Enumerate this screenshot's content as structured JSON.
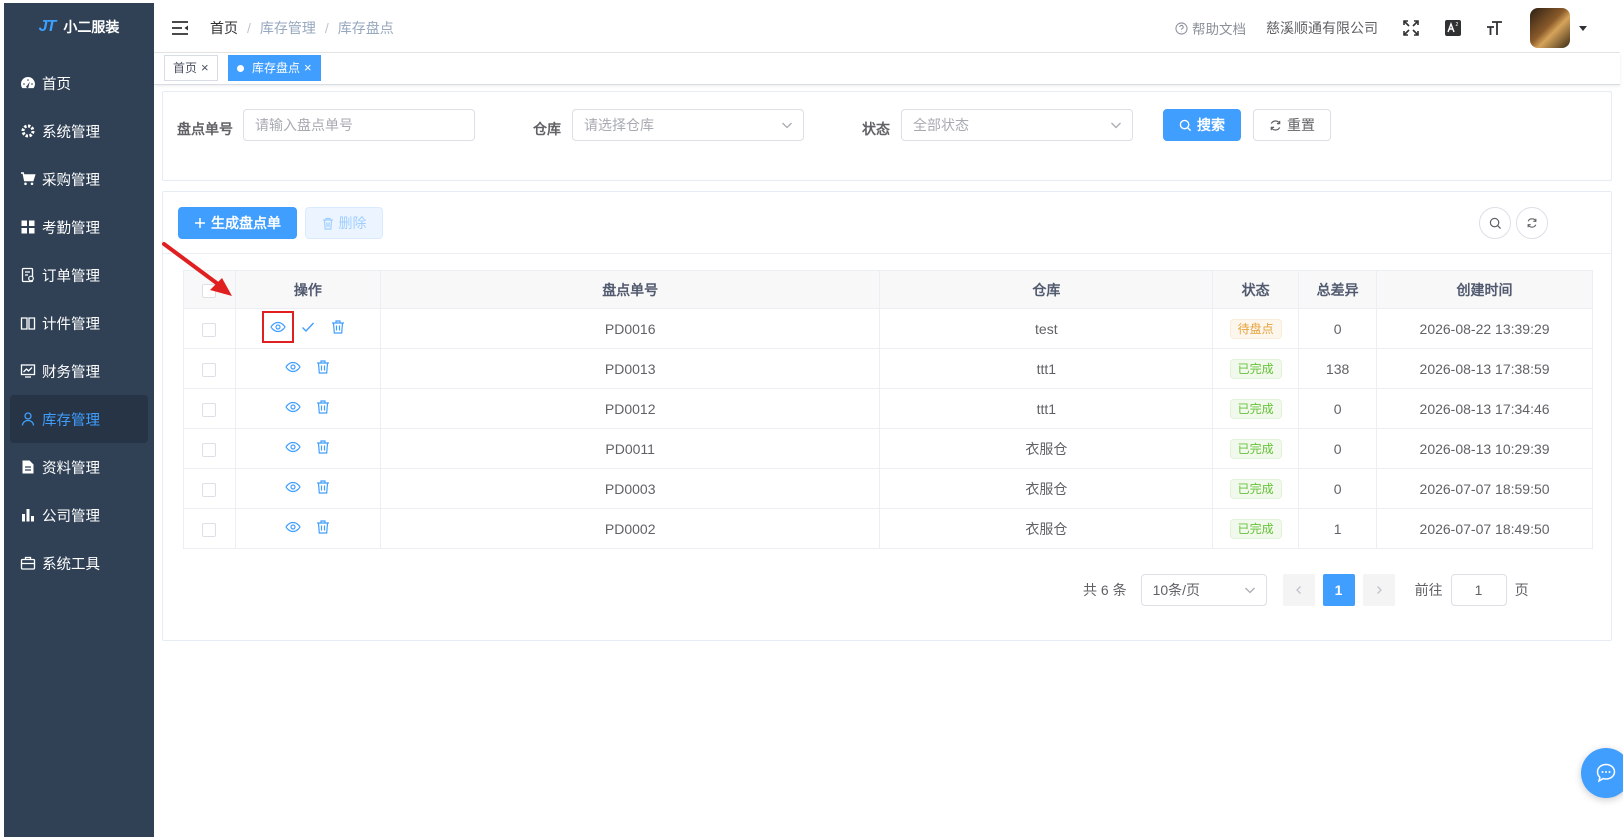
{
  "app": {
    "logo_text": "小二服装",
    "logo_mark": "JT"
  },
  "sidebar": {
    "items": [
      {
        "label": "首页",
        "icon": "dashboard-icon"
      },
      {
        "label": "系统管理",
        "icon": "gear-icon"
      },
      {
        "label": "采购管理",
        "icon": "cart-icon"
      },
      {
        "label": "考勤管理",
        "icon": "grid-icon"
      },
      {
        "label": "订单管理",
        "icon": "order-icon"
      },
      {
        "label": "计件管理",
        "icon": "book-icon"
      },
      {
        "label": "财务管理",
        "icon": "monitor-icon"
      },
      {
        "label": "库存管理",
        "icon": "user-icon",
        "active": true
      },
      {
        "label": "资料管理",
        "icon": "document-icon"
      },
      {
        "label": "公司管理",
        "icon": "bar-chart-icon"
      },
      {
        "label": "系统工具",
        "icon": "toolbox-icon"
      }
    ]
  },
  "header": {
    "breadcrumb": [
      "首页",
      "库存管理",
      "库存盘点"
    ],
    "separator": "/",
    "help_label": "帮助文档",
    "company_name": "慈溪顺通有限公司"
  },
  "tags": [
    {
      "label": "首页",
      "active": false
    },
    {
      "label": "库存盘点",
      "active": true
    }
  ],
  "search": {
    "fields": [
      {
        "label": "盘点单号",
        "placeholder": "请输入盘点单号",
        "type": "input"
      },
      {
        "label": "仓库",
        "placeholder": "请选择仓库",
        "type": "select"
      },
      {
        "label": "状态",
        "placeholder": "全部状态",
        "type": "select"
      }
    ],
    "search_label": "搜索",
    "reset_label": "重置"
  },
  "toolbar": {
    "create_label": "生成盘点单",
    "delete_label": "删除"
  },
  "table": {
    "columns": [
      "操作",
      "盘点单号",
      "仓库",
      "状态",
      "总差异",
      "创建时间"
    ],
    "rows": [
      {
        "no": "PD0016",
        "warehouse": "test",
        "status": "待盘点",
        "status_type": "pending",
        "diff": "0",
        "created": "2026-08-22 13:39:29"
      },
      {
        "no": "PD0013",
        "warehouse": "ttt1",
        "status": "已完成",
        "status_type": "done",
        "diff": "138",
        "created": "2026-08-13 17:38:59"
      },
      {
        "no": "PD0012",
        "warehouse": "ttt1",
        "status": "已完成",
        "status_type": "done",
        "diff": "0",
        "created": "2026-08-13 17:34:46"
      },
      {
        "no": "PD0011",
        "warehouse": "衣服仓",
        "status": "已完成",
        "status_type": "done",
        "diff": "0",
        "created": "2026-08-13 10:29:39"
      },
      {
        "no": "PD0003",
        "warehouse": "衣服仓",
        "status": "已完成",
        "status_type": "done",
        "diff": "0",
        "created": "2026-07-07 18:59:50"
      },
      {
        "no": "PD0002",
        "warehouse": "衣服仓",
        "status": "已完成",
        "status_type": "done",
        "diff": "1",
        "created": "2026-07-07 18:49:50"
      }
    ]
  },
  "pagination": {
    "total_label": "共 6 条",
    "page_size": "10条/页",
    "current_page": "1",
    "goto_prefix": "前往",
    "goto_value": "1",
    "goto_suffix": "页"
  },
  "colors": {
    "primary": "#409eff",
    "sidebar_bg": "#304156",
    "pending": "#e6a23c",
    "done": "#67c23a",
    "highlight": "#e02020"
  }
}
